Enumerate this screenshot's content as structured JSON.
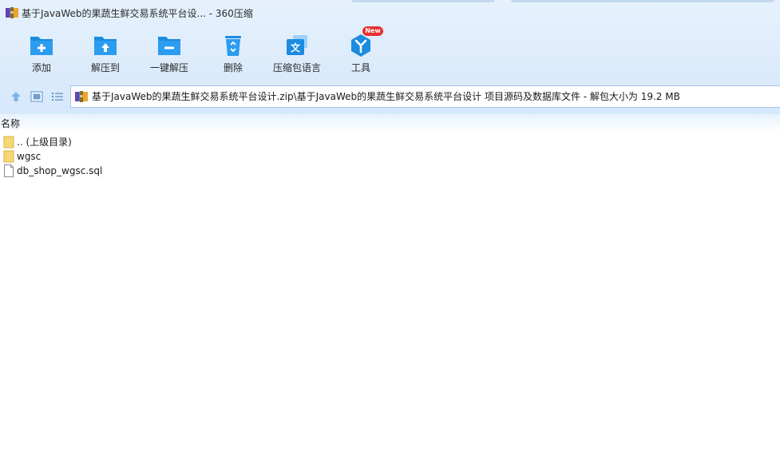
{
  "window": {
    "title": "基于JavaWeb的果蔬生鲜交易系统平台设... - 360压缩",
    "app_icon": "archive-icon"
  },
  "toolbar": {
    "buttons": [
      {
        "label": "添加",
        "icon": "folder-add-icon"
      },
      {
        "label": "解压到",
        "icon": "folder-extract-icon"
      },
      {
        "label": "一键解压",
        "icon": "folder-minus-icon"
      },
      {
        "label": "删除",
        "icon": "recycle-bin-icon"
      },
      {
        "label": "压缩包语言",
        "icon": "language-icon"
      },
      {
        "label": "工具",
        "icon": "tools-icon"
      }
    ],
    "new_badge": "New"
  },
  "navbar": {
    "up_icon": "up-arrow-icon",
    "view_icon": "view-mode-icon",
    "list_icon": "list-view-icon",
    "path": "基于JavaWeb的果蔬生鲜交易系统平台设计.zip\\基于JavaWeb的果蔬生鲜交易系统平台设计 项目源码及数据库文件 - 解包大小为 19.2 MB"
  },
  "file_list": {
    "column_name": "名称",
    "items": [
      {
        "name": ".. (上级目录)",
        "icon": "folder-icon"
      },
      {
        "name": "wgsc",
        "icon": "folder-icon"
      },
      {
        "name": "db_shop_wgsc.sql",
        "icon": "file-icon"
      }
    ]
  },
  "colors": {
    "accent": "#1b8ce0",
    "toolbar_bg": "#dcebfb",
    "badge": "#e8302f"
  }
}
